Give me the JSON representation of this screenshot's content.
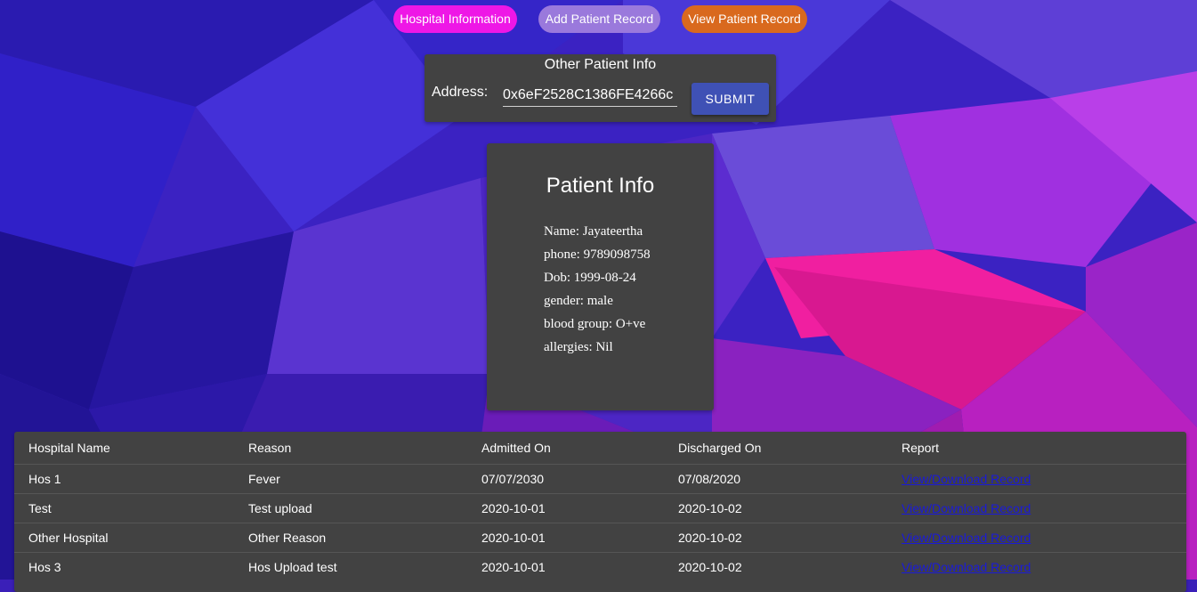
{
  "nav": {
    "hospital_information": "Hospital Information",
    "add_patient_record": "Add Patient Record",
    "view_patient_record": "View Patient Record"
  },
  "lookup": {
    "title": "Other Patient Info",
    "address_label": "Address:",
    "address_value": "0x6eF2528C1386FE4266c",
    "submit_label": "SUBMIT"
  },
  "patient": {
    "title": "Patient Info",
    "name": "Name: Jayateertha",
    "phone": "phone: 9789098758",
    "dob": "Dob: 1999-08-24",
    "gender": "gender: male",
    "blood_group": "blood group: O+ve",
    "allergies": "allergies: Nil"
  },
  "records": {
    "headers": [
      "Hospital Name",
      "Reason",
      "Admitted On",
      "Discharged On",
      "Report"
    ],
    "rows": [
      {
        "hospital": "Hos 1",
        "reason": "Fever",
        "admitted": "07/07/2030",
        "discharged": "07/08/2020",
        "report": "View/Download Record"
      },
      {
        "hospital": "Test",
        "reason": "Test upload",
        "admitted": "2020-10-01",
        "discharged": "2020-10-02",
        "report": "View/Download Record"
      },
      {
        "hospital": "Other Hospital",
        "reason": "Other Reason",
        "admitted": "2020-10-01",
        "discharged": "2020-10-02",
        "report": "View/Download Record"
      },
      {
        "hospital": "Hos 3",
        "reason": "Hos Upload test",
        "admitted": "2020-10-01",
        "discharged": "2020-10-02",
        "report": "View/Download Record"
      }
    ]
  },
  "colors": {
    "nav_hospital": "#ee17e6",
    "nav_add": "#9a79dc",
    "nav_view": "#d9691e",
    "panel": "#424242",
    "submit": "#3f51b5",
    "link": "#1a1ad8"
  }
}
